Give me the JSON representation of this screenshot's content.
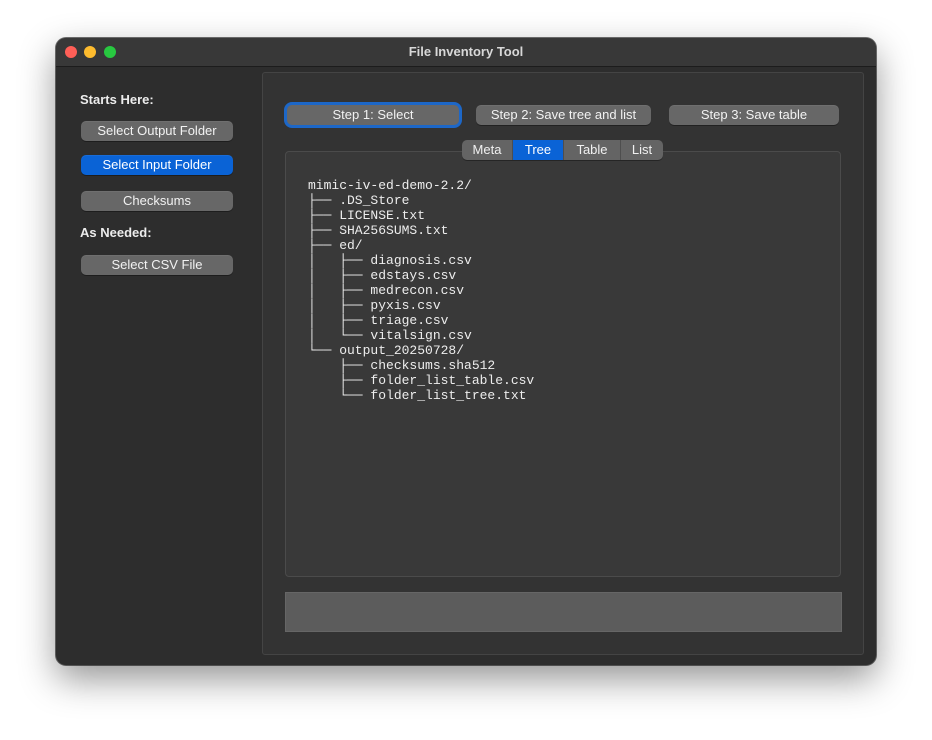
{
  "window": {
    "title": "File Inventory Tool"
  },
  "sidebar": {
    "starts_heading": "Starts Here:",
    "select_output_label": "Select Output Folder",
    "select_input_label": "Select Input Folder",
    "checksums_label": "Checksums",
    "as_needed_heading": "As Needed:",
    "select_csv_label": "Select CSV File"
  },
  "steps": {
    "step1_label": "Step 1: Select",
    "step2_label": "Step 2: Save tree and list",
    "step3_label": "Step 3: Save table"
  },
  "tabs": {
    "selected": "Tree",
    "items": [
      {
        "label": "Meta"
      },
      {
        "label": "Tree"
      },
      {
        "label": "Table"
      },
      {
        "label": "List"
      }
    ]
  },
  "tree": {
    "lines": [
      "mimic-iv-ed-demo-2.2/",
      "├── .DS_Store",
      "├── LICENSE.txt",
      "├── SHA256SUMS.txt",
      "├── ed/",
      "│   ├── diagnosis.csv",
      "│   ├── edstays.csv",
      "│   ├── medrecon.csv",
      "│   ├── pyxis.csv",
      "│   ├── triage.csv",
      "│   └── vitalsign.csv",
      "└── output_20250728/",
      "    ├── checksums.sha512",
      "    ├── folder_list_table.csv",
      "    └── folder_list_tree.txt"
    ]
  },
  "status": {
    "text": ""
  },
  "colors": {
    "window_bg": "#2d2d2d",
    "panel_bg": "#333333",
    "button_bg": "#676767",
    "accent": "#0a63d6",
    "traffic_close": "#ff5f57",
    "traffic_minimize": "#febc2e",
    "traffic_maximize": "#28c840"
  }
}
